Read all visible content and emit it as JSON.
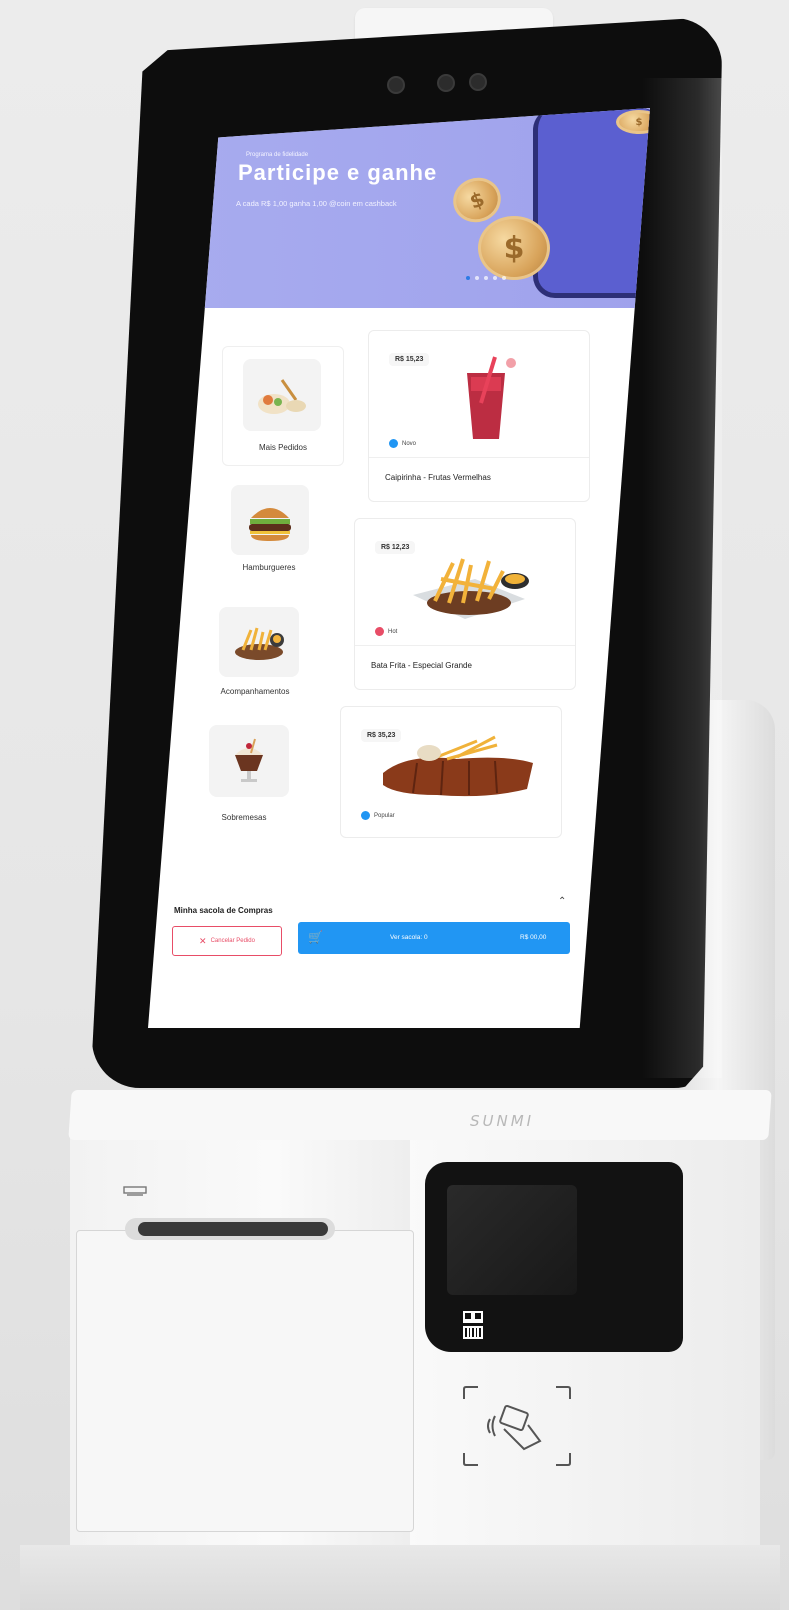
{
  "device": {
    "brand": "SUNMI"
  },
  "banner": {
    "eyebrow": "Programa de fidelidade",
    "title": "Participe e ganhe",
    "description": "A cada R$ 1,00  ganha 1,00 @coin em cashback",
    "coin_symbol": "$",
    "dots": 5,
    "active_dot": 0
  },
  "categories": [
    {
      "label": "Mais Pedidos",
      "icon": "salad-icon"
    },
    {
      "label": "Hamburgueres",
      "icon": "burger-icon"
    },
    {
      "label": "Acompanhamentos",
      "icon": "fries-icon"
    },
    {
      "label": "Sobremesas",
      "icon": "sundae-icon"
    }
  ],
  "products": [
    {
      "price": "R$ 15,23",
      "tag": "Novo",
      "tag_color": "#2196f3",
      "name": "Caipirinha - Frutas Vermelhas",
      "icon": "drink-icon"
    },
    {
      "price": "R$ 12,23",
      "tag": "Hot",
      "tag_color": "#e84d67",
      "name": "Bata Frita - Especial Grande",
      "icon": "fries-icon"
    },
    {
      "price": "R$ 35,23",
      "tag": "Popular",
      "tag_color": "#2196f3",
      "name": "",
      "icon": "ribs-icon"
    }
  ],
  "bag": {
    "title": "Minha sacola de Compras",
    "cancel_label": "Cancelar Pedido",
    "view_label": "Ver sacola: 0",
    "total": "R$ 00,00"
  },
  "colors": {
    "accent": "#2196f3",
    "banner": "#a8acef",
    "cancel": "#e84d67"
  }
}
